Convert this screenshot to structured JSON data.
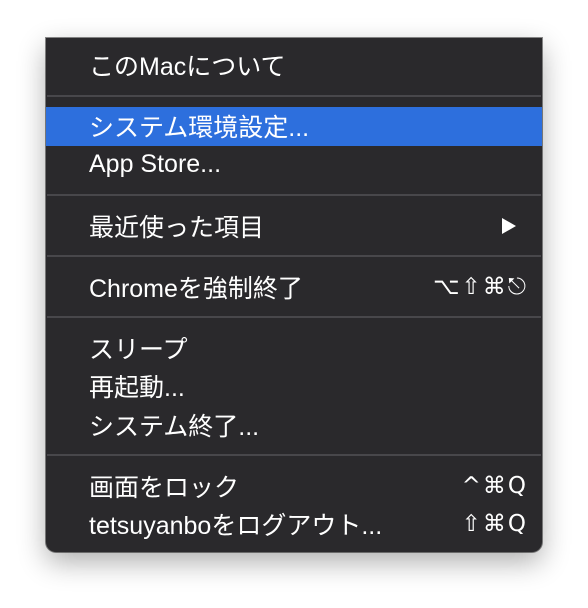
{
  "colors": {
    "menu_bg": "#2a292c",
    "highlight": "#2d6fdd",
    "text": "#ffffff",
    "separator": "#48474b"
  },
  "menu": {
    "about": {
      "label": "このMacについて"
    },
    "system_preferences": {
      "label": "システム環境設定...",
      "highlighted": true
    },
    "app_store": {
      "label": "App Store..."
    },
    "recent_items": {
      "label": "最近使った項目",
      "submenu_icon": "submenu-arrow-icon"
    },
    "force_quit": {
      "label": "Chromeを強制終了",
      "shortcut": "⌥⇧⌘⎋"
    },
    "sleep": {
      "label": "スリープ"
    },
    "restart": {
      "label": "再起動..."
    },
    "shut_down": {
      "label": "システム終了..."
    },
    "lock_screen": {
      "label": "画面をロック",
      "shortcut": "^⌘Q"
    },
    "log_out": {
      "label": "tetsuyanboをログアウト...",
      "shortcut": "⇧⌘Q"
    }
  }
}
